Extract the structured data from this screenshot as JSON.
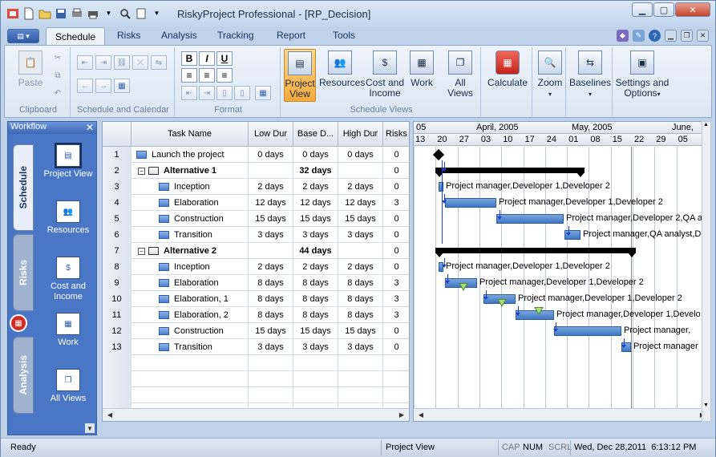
{
  "window": {
    "title": "RiskyProject Professional - [RP_Decision]"
  },
  "tabs": [
    "Schedule",
    "Risks",
    "Analysis",
    "Tracking",
    "Report",
    "Tools"
  ],
  "ribbon": {
    "clipboard": {
      "label": "Clipboard",
      "paste": "Paste"
    },
    "schedule_calendar": {
      "label": "Schedule and Calendar"
    },
    "format": {
      "label": "Format",
      "bold": "B",
      "italic": "I",
      "underline": "U"
    },
    "views": {
      "label": "Schedule Views",
      "project_view": "Project View",
      "resources": "Resources",
      "cost_income": "Cost and Income",
      "work": "Work",
      "all_views": "All Views"
    },
    "calculate": "Calculate",
    "zoom": "Zoom",
    "baselines": "Baselines",
    "settings": "Settings and Options"
  },
  "workflow": {
    "title": "Workflow",
    "vtabs": [
      "Schedule",
      "Risks",
      "Analysis"
    ],
    "items": [
      "Project View",
      "Resources",
      "Cost and Income",
      "Work",
      "All Views"
    ]
  },
  "grid": {
    "headers": [
      "Task Name",
      "Low Dur",
      "Base D...",
      "High Dur",
      "Risks"
    ],
    "rows": [
      {
        "n": "1",
        "name": "Launch the project",
        "summary": false,
        "indent": 0,
        "low": "0 days",
        "base": "0 days",
        "high": "0 days",
        "risks": "0"
      },
      {
        "n": "2",
        "name": "Alternative 1",
        "summary": true,
        "indent": 0,
        "low": "",
        "base": "32 days",
        "high": "",
        "risks": "0"
      },
      {
        "n": "3",
        "name": "Inception",
        "summary": false,
        "indent": 1,
        "low": "2 days",
        "base": "2 days",
        "high": "2 days",
        "risks": "0"
      },
      {
        "n": "4",
        "name": "Elaboration",
        "summary": false,
        "indent": 1,
        "low": "12 days",
        "base": "12 days",
        "high": "12 days",
        "risks": "3"
      },
      {
        "n": "5",
        "name": "Construction",
        "summary": false,
        "indent": 1,
        "low": "15 days",
        "base": "15 days",
        "high": "15 days",
        "risks": "0"
      },
      {
        "n": "6",
        "name": "Transition",
        "summary": false,
        "indent": 1,
        "low": "3 days",
        "base": "3 days",
        "high": "3 days",
        "risks": "0"
      },
      {
        "n": "7",
        "name": "Alternative 2",
        "summary": true,
        "indent": 0,
        "low": "",
        "base": "44 days",
        "high": "",
        "risks": "0"
      },
      {
        "n": "8",
        "name": "Inception",
        "summary": false,
        "indent": 1,
        "low": "2 days",
        "base": "2 days",
        "high": "2 days",
        "risks": "0"
      },
      {
        "n": "9",
        "name": "Elaboration",
        "summary": false,
        "indent": 1,
        "low": "8 days",
        "base": "8 days",
        "high": "8 days",
        "risks": "3"
      },
      {
        "n": "10",
        "name": "Elaboration, 1",
        "summary": false,
        "indent": 1,
        "low": "8 days",
        "base": "8 days",
        "high": "8 days",
        "risks": "3"
      },
      {
        "n": "11",
        "name": "Elaboration, 2",
        "summary": false,
        "indent": 1,
        "low": "8 days",
        "base": "8 days",
        "high": "8 days",
        "risks": "3"
      },
      {
        "n": "12",
        "name": "Construction",
        "summary": false,
        "indent": 1,
        "low": "15 days",
        "base": "15 days",
        "high": "15 days",
        "risks": "0"
      },
      {
        "n": "13",
        "name": "Transition",
        "summary": false,
        "indent": 1,
        "low": "3 days",
        "base": "3 days",
        "high": "3 days",
        "risks": "0"
      }
    ]
  },
  "gantt": {
    "months": [
      "05",
      "April, 2005",
      "May, 2005",
      "June,"
    ],
    "days": [
      "13",
      "20",
      "27",
      "03",
      "10",
      "17",
      "24",
      "01",
      "08",
      "15",
      "22",
      "29",
      "05"
    ],
    "resources": [
      "",
      "",
      "Project manager,Developer 1,Developer 2",
      "Project manager,Developer 1,Developer 2",
      "Project manager,Developer 2,QA a",
      "Project manager,QA analyst,Dev",
      "",
      "Project manager,Developer 1,Developer 2",
      "Project manager,Developer 1,Developer 2",
      "Project manager,Developer 1,Developer 2",
      "Project manager,Developer 1,Develo",
      "Project manager,",
      "Project manager"
    ]
  },
  "status": {
    "left": "Ready",
    "view": "Project View",
    "cap": "CAP",
    "num": "NUM",
    "scrl": "SCRL",
    "datetime": "Wed, Dec 28,2011  6:13:12 PM"
  }
}
